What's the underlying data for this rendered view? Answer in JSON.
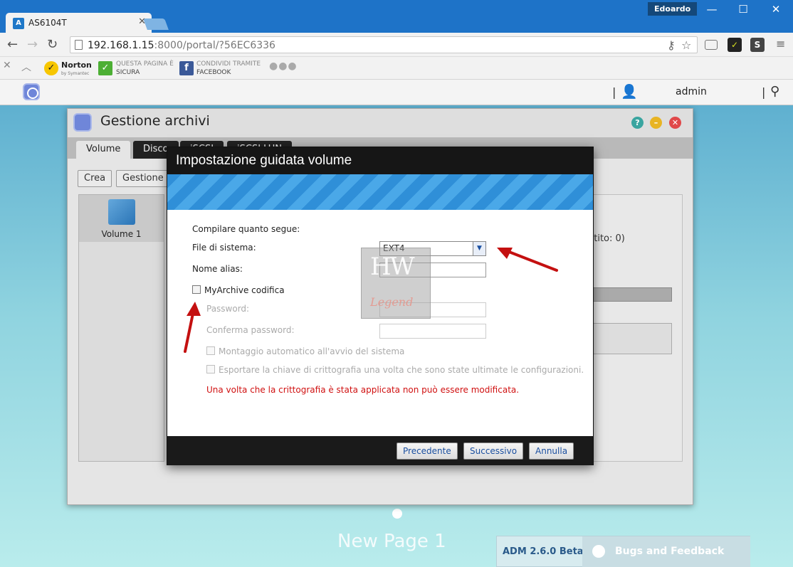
{
  "browser": {
    "tab_title": "AS6104T",
    "tab_favicon": "asustor-icon",
    "user_badge": "Edoardo",
    "url_host": "192.168.1.15",
    "url_path": ":8000/portal/?56EC6336",
    "bookmarks": [
      {
        "name": "norton",
        "label": "Norton",
        "sublabel": "by Symantec"
      },
      {
        "name": "safe-page",
        "label": "QUESTA PAGINA È",
        "sublabel": "SICURA"
      },
      {
        "name": "share-facebook",
        "label": "CONDIVIDI TRAMITE",
        "sublabel": "FACEBOOK"
      }
    ]
  },
  "adm": {
    "user": "admin"
  },
  "app_window": {
    "title": "Gestione archivi",
    "tabs": [
      "Volume",
      "Disco",
      "iSCSI",
      "iSCSI LUN"
    ],
    "buttons": [
      "Crea",
      "Gestione"
    ],
    "volume_label": "Volume 1",
    "detail_text": "ntito: 0)"
  },
  "wizard": {
    "title": "Impostazione guidata volume",
    "intro": "Compilare quanto segue:",
    "fs_label": "File di sistema:",
    "fs_value": "EXT4",
    "alias_label": "Nome alias:",
    "encrypt_label": "MyArchive codifica",
    "password_label": "Password:",
    "confirm_label": "Conferma password:",
    "automount_label": "Montaggio automatico all'avvio del sistema",
    "export_label": "Esportare la chiave di crittografia una volta che sono state ultimate le configurazioni.",
    "warning": "Una volta che la crittografia è stata applicata non può essere modificata.",
    "btn_prev": "Precedente",
    "btn_next": "Successivo",
    "btn_cancel": "Annulla"
  },
  "watermark": {
    "top": "HW",
    "bottom": "Legend"
  },
  "desktop": {
    "page_label": "New Page 1",
    "version": "ADM 2.6.0 Beta",
    "feedback": "Bugs and Feedback"
  }
}
